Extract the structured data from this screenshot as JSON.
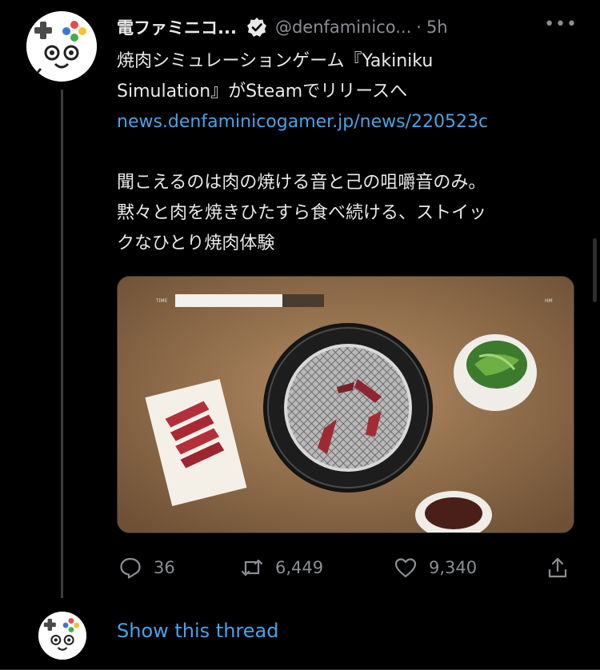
{
  "tweet": {
    "display_name": "電ファミニコ...",
    "handle": "@denfaminico...",
    "separator": "·",
    "time": "5h",
    "more_icon": "more-icon",
    "text_line1": "焼肉シミュレーションゲーム『Yakiniku",
    "text_line2": "Simulation』がSteamでリリースへ",
    "link": "news.denfaminicogamer.jp/news/220523c",
    "text_line4": "聞こえるのは肉の焼ける音と己の咀嚼音のみ。",
    "text_line5": "黙々と肉を焼きひたすら食べ続ける、ストイッ",
    "text_line6": "クなひとり焼肉体験",
    "media": {
      "timer_fraction": 0.72
    },
    "actions": {
      "reply_count": "36",
      "retweet_count": "6,449",
      "like_count": "9,340"
    }
  },
  "thread": {
    "show_thread_label": "Show this thread"
  },
  "colors": {
    "background": "#000000",
    "link": "#4aa2e8",
    "muted": "#8b8f94"
  }
}
